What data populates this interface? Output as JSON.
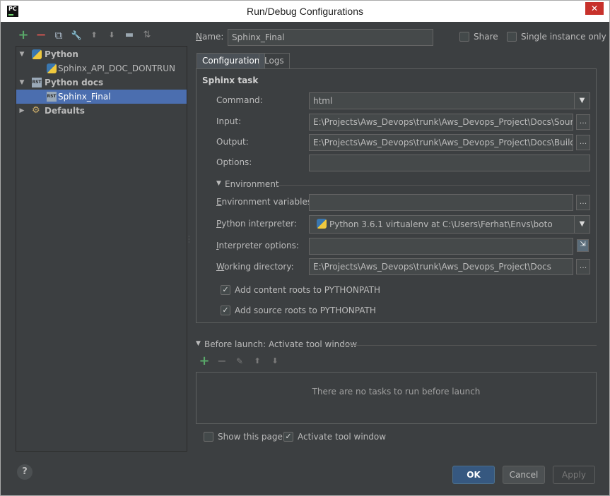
{
  "window": {
    "title": "Run/Debug Configurations",
    "app_icon": "PC",
    "close": "✕"
  },
  "toolbar": {
    "add": "+",
    "remove": "−",
    "copy": "⧉",
    "settings": "🔧",
    "up": "⬆",
    "down": "⬇",
    "folder": "▬",
    "sort": "⇅"
  },
  "tree": {
    "python": "Python",
    "python_child": "Sphinx_API_DOC_DONTRUN",
    "python_docs": "Python docs",
    "python_docs_child": "Sphinx_Final",
    "defaults": "Defaults",
    "rst_badge": "RST"
  },
  "name": {
    "label": "Name:",
    "value": "Sphinx_Final",
    "share": "Share",
    "single_instance": "Single instance only"
  },
  "tabs": [
    "Configuration",
    "Logs"
  ],
  "sphinx": {
    "section_title": "Sphinx task",
    "command_label": "Command:",
    "command_value": "html",
    "input_label": "Input:",
    "input_value": "E:\\Projects\\Aws_Devops\\trunk\\Aws_Devops_Project\\Docs\\Source",
    "output_label": "Output:",
    "output_value": "E:\\Projects\\Aws_Devops\\trunk\\Aws_Devops_Project\\Docs\\Build",
    "options_label": "Options:",
    "options_value": "",
    "browse": "..."
  },
  "environment": {
    "section_title": "Environment",
    "env_vars_label": "Environment variables:",
    "env_vars_value": "",
    "interpreter_label": "Python interpreter:",
    "interpreter_value": "Python 3.6.1 virtualenv at C:\\Users\\Ferhat\\Envs\\boto",
    "interp_options_label": "Interpreter options:",
    "interp_options_value": "",
    "working_dir_label": "Working directory:",
    "working_dir_value": "E:\\Projects\\Aws_Devops\\trunk\\Aws_Devops_Project\\Docs",
    "add_content_roots": "Add content roots to PYTHONPATH",
    "add_source_roots": "Add source roots to PYTHONPATH"
  },
  "before_launch": {
    "title": "Before launch: Activate tool window",
    "empty_text": "There are no tasks to run before launch",
    "show_this_page": "Show this page",
    "activate_tool_window": "Activate tool window"
  },
  "buttons": {
    "ok": "OK",
    "cancel": "Cancel",
    "apply": "Apply",
    "help": "?"
  },
  "colors": {
    "background": "#3c3f41",
    "selection": "#4b6eaf",
    "default_button": "#365880",
    "add_green": "#59a869",
    "remove_red": "#c75450"
  }
}
